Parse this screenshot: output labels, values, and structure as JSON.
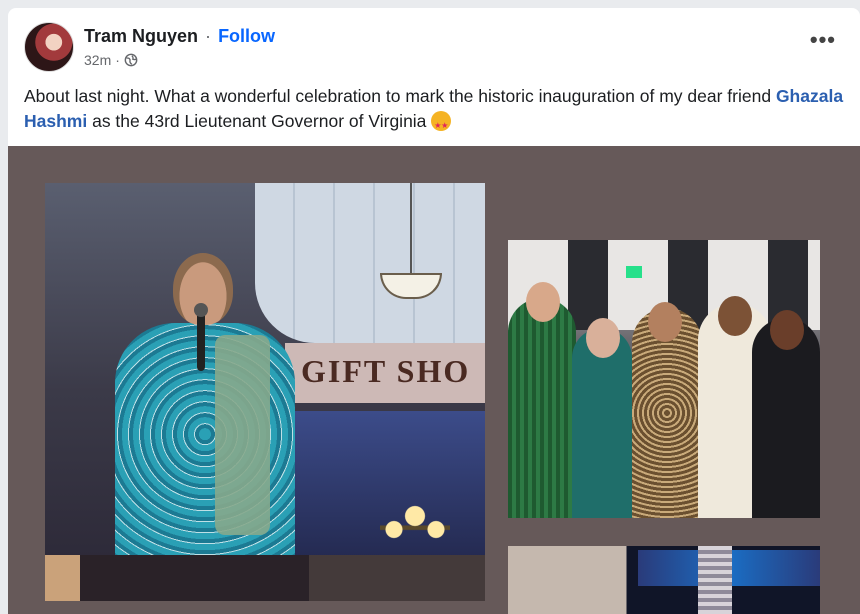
{
  "post": {
    "author": "Tram Nguyen",
    "separator": "·",
    "follow_label": "Follow",
    "time": "32m",
    "meta_separator": "·",
    "privacy_icon": "globe-icon",
    "more_label": "•••",
    "text_before": "About last night. What a wonderful celebration to mark the historic inauguration of my dear friend ",
    "mention": "Ghazala Hashmi",
    "text_after": " as the 43rd Lieutenant Governor of Virginia ",
    "emoji": "star-struck-emoji"
  },
  "photos": {
    "photo1_sign": "GIFT SHO"
  },
  "colors": {
    "link": "#0866ff",
    "mention": "#2b5fb0",
    "photo_background": "#665959"
  }
}
